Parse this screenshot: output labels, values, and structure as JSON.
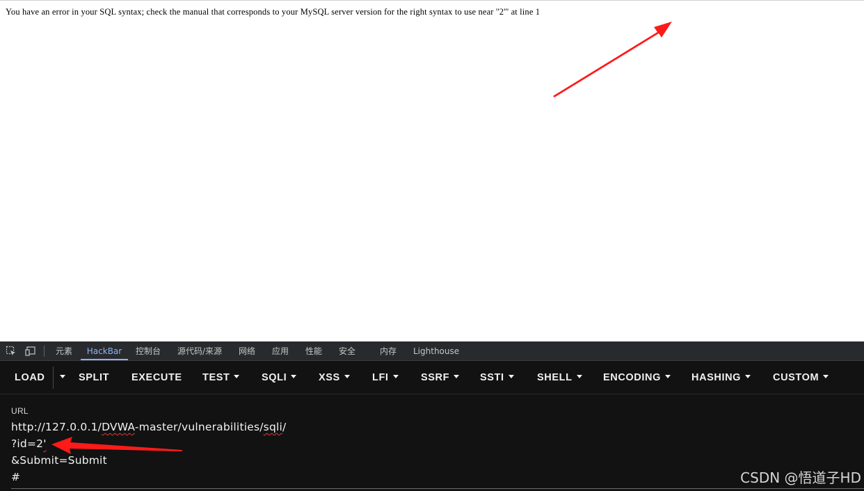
{
  "page": {
    "error_message": "You have an error in your SQL syntax; check the manual that corresponds to your MySQL server version for the right syntax to use near ''2''' at line 1"
  },
  "devtools": {
    "tabs": [
      "元素",
      "HackBar",
      "控制台",
      "源代码/来源",
      "网络",
      "应用",
      "性能",
      "安全",
      "内存",
      "Lighthouse"
    ],
    "active_tab": "HackBar"
  },
  "hackbar": {
    "load": "LOAD",
    "split": "SPLIT",
    "execute": "EXECUTE",
    "test": "TEST",
    "sqli": "SQLI",
    "xss": "XSS",
    "lfi": "LFI",
    "ssrf": "SSRF",
    "ssti": "SSTI",
    "shell": "SHELL",
    "encoding": "ENCODING",
    "hashing": "HASHING",
    "custom": "CUSTOM",
    "url_label": "URL",
    "url_host": "http://127.0.0.1/",
    "url_path_a": "DVWA",
    "url_path_b": "-master/vulnerabilities/",
    "url_path_c": "sqli",
    "url_path_d": "/",
    "url_query_key": "?id=2",
    "url_query_val": "'",
    "url_submit": "&Submit=Submit",
    "url_hash": "#"
  },
  "watermark": "CSDN @悟道子HD",
  "colors": {
    "accent": "#8ab4f8",
    "annotation_arrow": "#ff1a1a",
    "hackbar_bg": "#121212"
  },
  "icons": [
    "inspect-element-icon",
    "device-toolbar-icon",
    "dropdown-caret-icon"
  ]
}
